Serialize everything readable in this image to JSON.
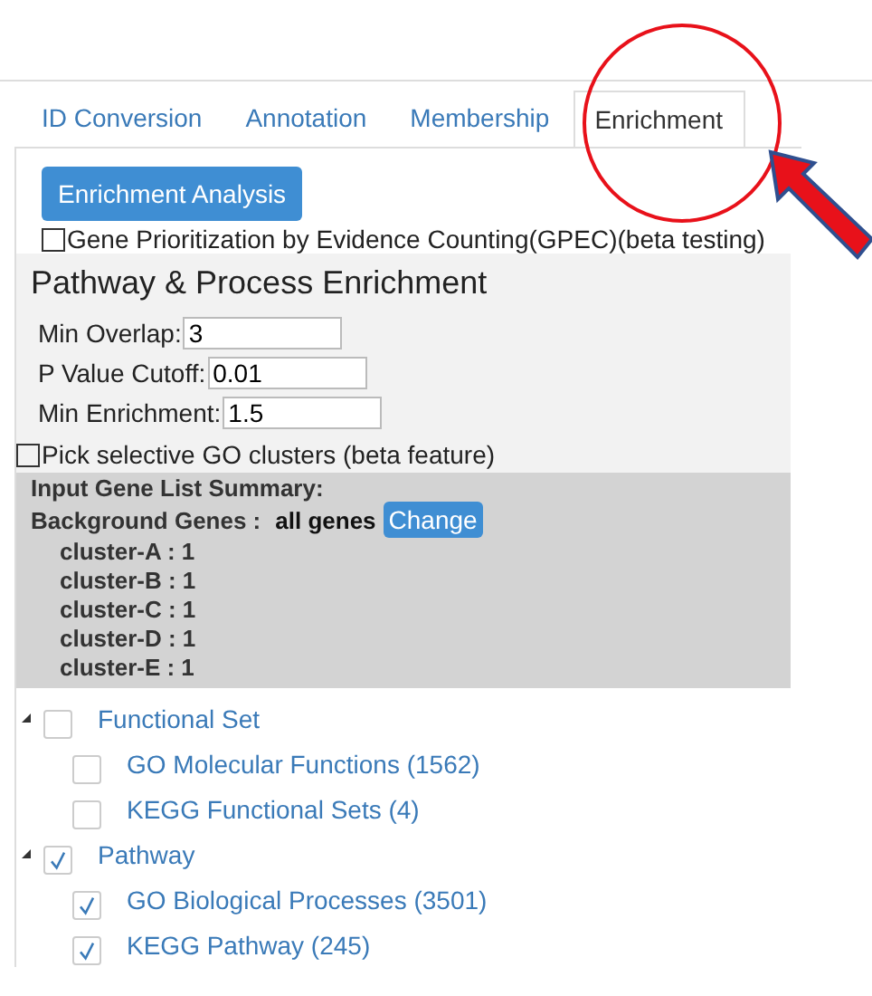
{
  "tabs": [
    {
      "label": "ID Conversion",
      "selected": false
    },
    {
      "label": "Annotation",
      "selected": false
    },
    {
      "label": "Membership",
      "selected": false
    },
    {
      "label": "Enrichment",
      "selected": true
    }
  ],
  "analysis_button": "Enrichment Analysis",
  "gpec": {
    "label": "Gene Prioritization by Evidence Counting(GPEC)(beta testing)",
    "checked": false
  },
  "section_title": "Pathway & Process Enrichment",
  "fields": [
    {
      "label": "Min Overlap:",
      "value": "3"
    },
    {
      "label": "P Value Cutoff:",
      "value": "0.01"
    },
    {
      "label": "Min Enrichment:",
      "value": "1.5"
    }
  ],
  "go_clusters": {
    "label": "Pick selective GO clusters (beta feature)",
    "checked": false
  },
  "summary": {
    "title": "Input Gene List Summary:",
    "background_label": "Background Genes :",
    "background_value": "all genes",
    "change_button": "Change",
    "clusters": [
      "cluster-A : 1",
      "cluster-B : 1",
      "cluster-C : 1",
      "cluster-D : 1",
      "cluster-E : 1"
    ]
  },
  "tree": [
    {
      "label": "Functional Set",
      "checked": false,
      "expanded": true,
      "children": [
        {
          "label": "GO Molecular Functions (1562)",
          "checked": false
        },
        {
          "label": "KEGG Functional Sets (4)",
          "checked": false
        }
      ]
    },
    {
      "label": "Pathway",
      "checked": true,
      "expanded": true,
      "children": [
        {
          "label": "GO Biological Processes (3501)",
          "checked": true
        },
        {
          "label": "KEGG Pathway (245)",
          "checked": true
        }
      ]
    }
  ]
}
